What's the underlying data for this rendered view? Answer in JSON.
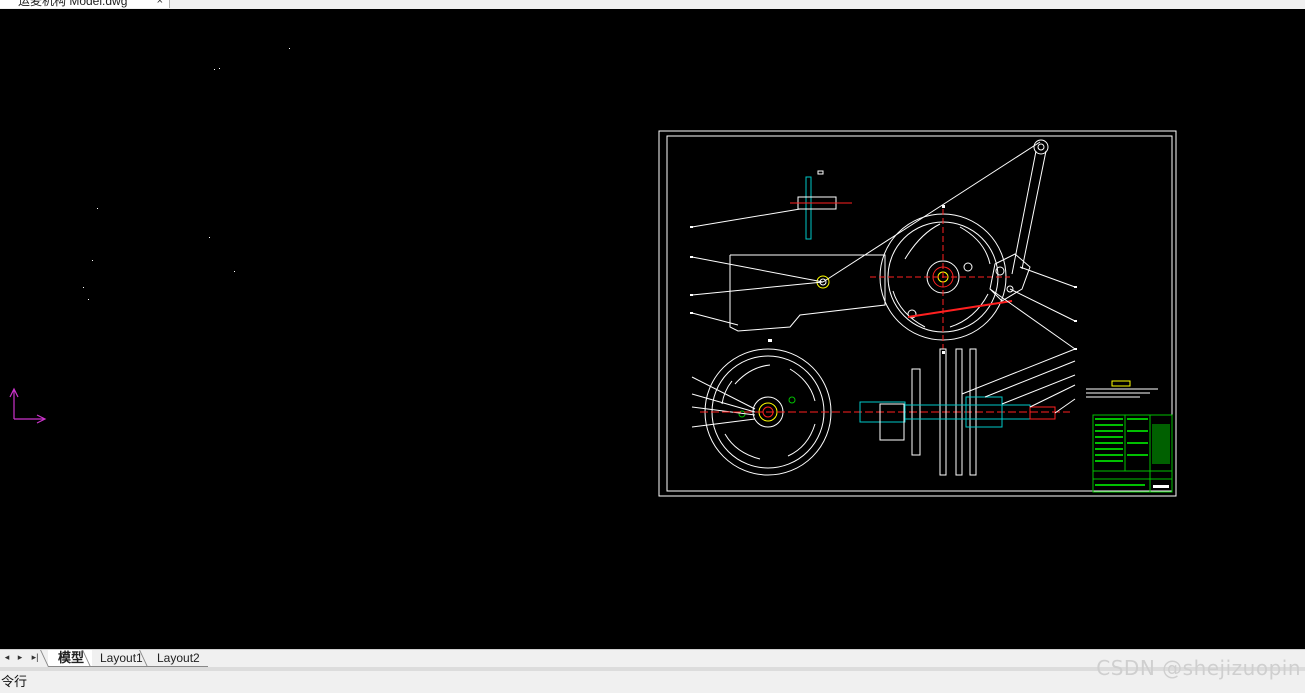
{
  "document": {
    "tab_title": "运麦机构 Model.dwg",
    "close_glyph": "×"
  },
  "layout_tabs": {
    "nav": [
      "◂",
      "▸",
      "▸|"
    ],
    "tabs": [
      {
        "label": "模型",
        "active": true
      },
      {
        "label": "Layout1",
        "active": false
      },
      {
        "label": "Layout2",
        "active": false
      }
    ]
  },
  "command_line": {
    "label": "令行",
    "value": ""
  },
  "watermark": "CSDN @shejizuopin",
  "colors": {
    "canvas_bg": "#000000",
    "ucs_icon": "#cc33cc",
    "line": "#ffffff",
    "center_line": "#ff2020",
    "section_fill": "#00c8c8",
    "title_block": "#00c000",
    "accent_yellow": "#ffff00"
  },
  "icons": {
    "ucs": "ucs-axis-icon",
    "tab_close": "close-icon"
  }
}
